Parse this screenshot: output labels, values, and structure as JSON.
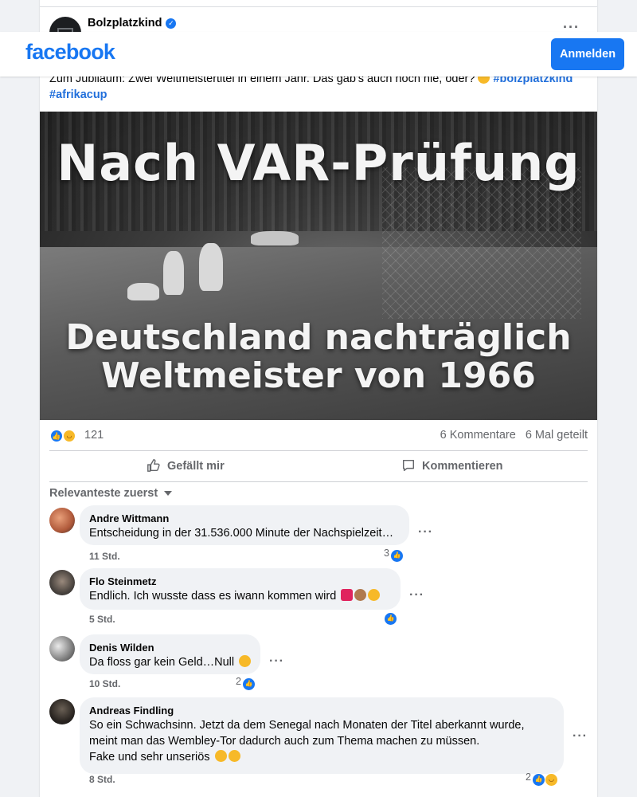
{
  "app": {
    "logo_text": "facebook",
    "login_label": "Anmelden",
    "brand_color": "#1877f2"
  },
  "post": {
    "author": "Bolzplatzkind",
    "text_prefix": "Zum Jubiläum: Zwei Weltmeistertitel in einem Jahr. Das gab's auch noch nie, oder? ",
    "hashtag1": "#bolzplatzkind",
    "hashtag2": "#afrikacup",
    "image_title": "Nach VAR-Prüfung",
    "image_sub1": "Deutschland nachträglich",
    "image_sub2": "Weltmeister von 1966",
    "reaction_count": "121",
    "comments_count": "6 Kommentare",
    "shares_count": "6 Mal geteilt"
  },
  "actions": {
    "like": "Gefällt mir",
    "comment": "Kommentieren"
  },
  "comments_sort": "Relevanteste zuerst",
  "comments": [
    {
      "name": "Andre Wittmann",
      "text": "Entscheidung in der 31.536.000 Minute der Nachspielzeit…",
      "time": "11 Std.",
      "reactions": "3"
    },
    {
      "name": "Flo Steinmetz",
      "text": "Endlich. Ich wusste dass es iwann kommen wird ",
      "time": "5 Std.",
      "reactions": ""
    },
    {
      "name": "Denis Wilden",
      "text": "Da floss gar kein Geld…Null ",
      "time": "10 Std.",
      "reactions": "2"
    },
    {
      "name": "Andreas Findling",
      "line1": "So ein Schwachsinn. Jetzt da dem Senegal nach Monaten der Titel aberkannt wurde,",
      "line2": "meint man das Wembley-Tor dadurch auch zum Thema machen zu müssen.",
      "line3": "Fake und sehr unseriös ",
      "time": "8 Std.",
      "reactions": "2"
    }
  ]
}
